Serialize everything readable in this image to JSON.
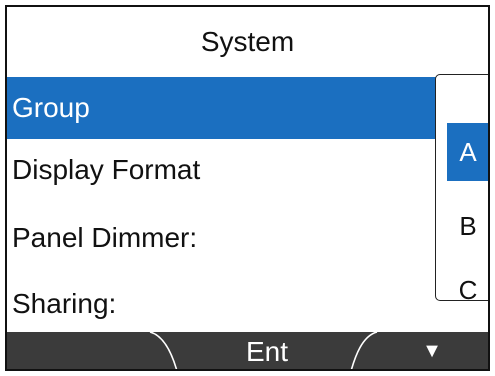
{
  "title": "System",
  "menu": [
    {
      "label": "Group",
      "selected": true
    },
    {
      "label": "Display Format",
      "selected": false
    },
    {
      "label": "Panel Dimmer:",
      "selected": false
    },
    {
      "label": "Sharing:",
      "selected": false
    }
  ],
  "popup": {
    "options": [
      "A",
      "B",
      "C"
    ],
    "selected_option": "A"
  },
  "softkeys": {
    "center": "Ent",
    "right_icon": "▼",
    "right_icon_name": "down-arrow-icon"
  },
  "colors": {
    "selection": "#1b6fc0",
    "softkey_bar": "#3b3b3b"
  }
}
